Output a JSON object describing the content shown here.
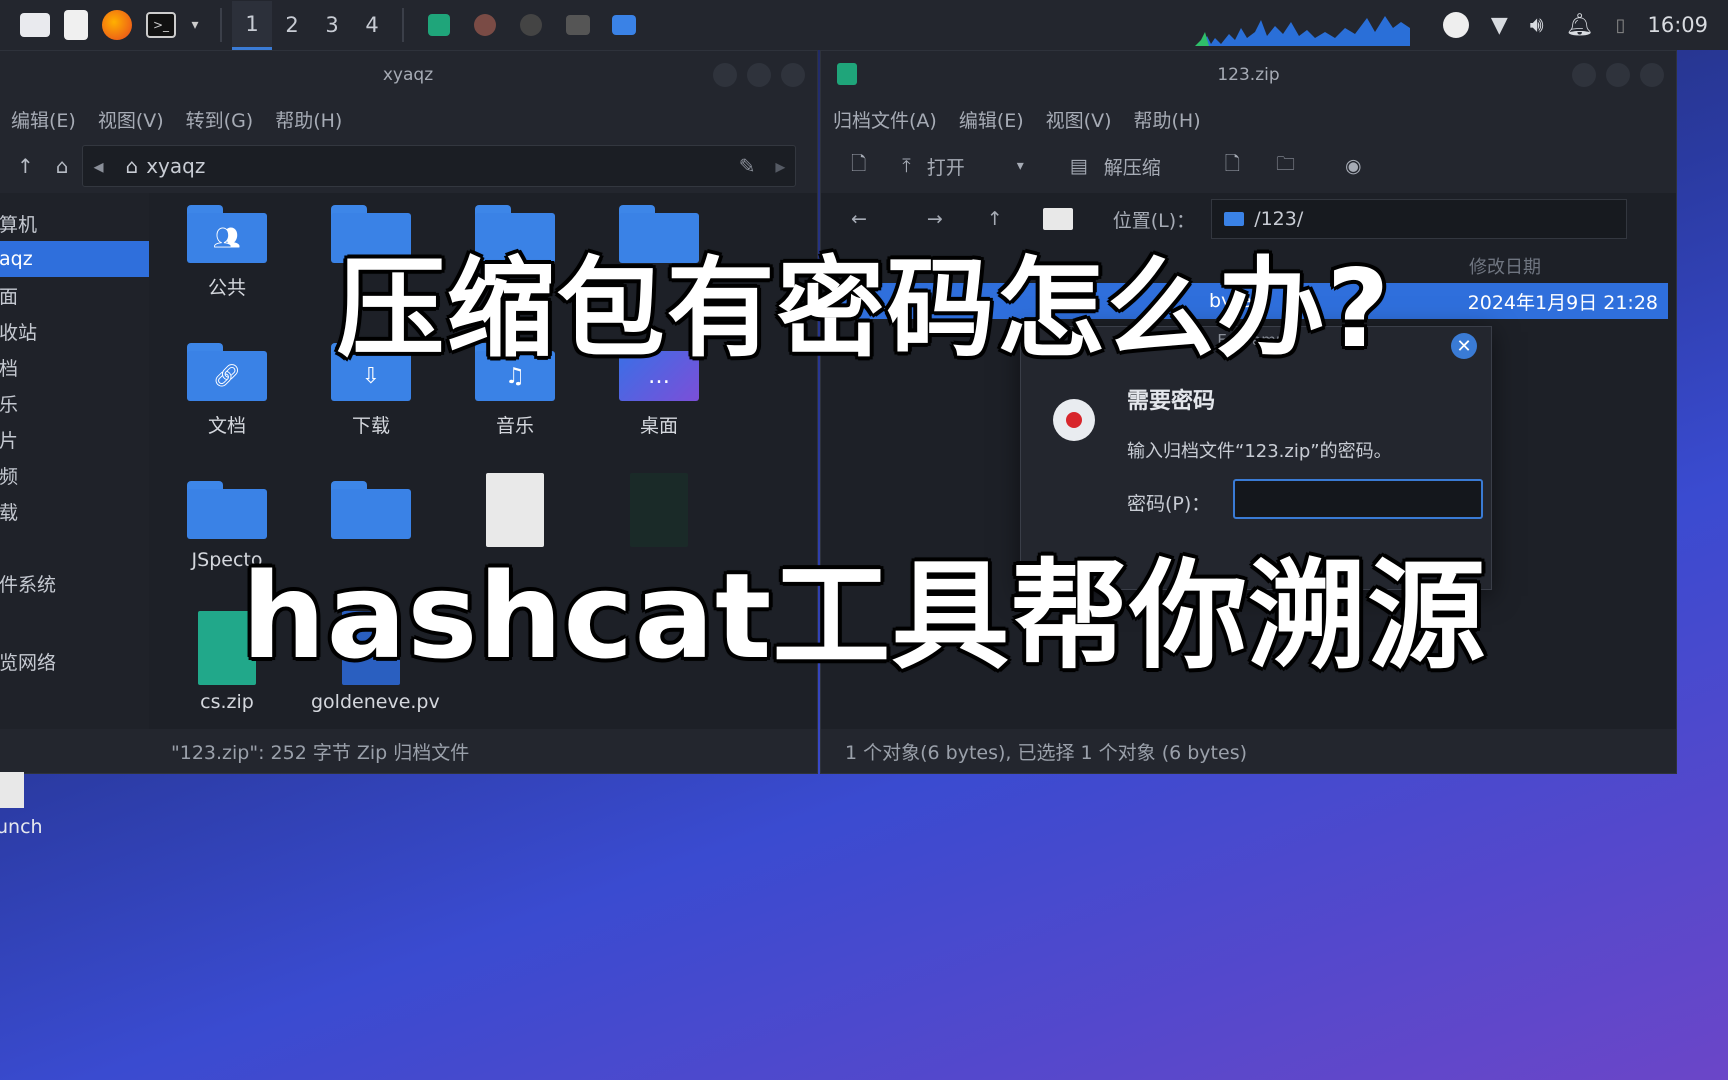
{
  "taskbar": {
    "workspaces": [
      "1",
      "2",
      "3",
      "4"
    ],
    "clock": "16:09"
  },
  "file_manager": {
    "title": "xyaqz",
    "menu": [
      "编辑(E)",
      "视图(V)",
      "转到(G)",
      "帮助(H)"
    ],
    "path": "xyaqz",
    "sidebar": [
      "算机",
      "aqz",
      "面",
      "收站",
      "档",
      "乐",
      "片",
      "频",
      "载",
      "件系统",
      "览网络"
    ],
    "files": [
      "公共",
      "文档",
      "下载",
      "音乐",
      "桌面",
      "JSpecto",
      "cs.zip",
      "goldeneve.pv"
    ],
    "status": "\"123.zip\": 252 字节 Zip 归档文件"
  },
  "archive_manager": {
    "title": "123.zip",
    "menu": [
      "归档文件(A)",
      "编辑(E)",
      "视图(V)",
      "帮助(H)"
    ],
    "toolbar": {
      "open": "打开",
      "extract": "解压缩"
    },
    "location_label": "位置(L)：",
    "location": "/123/",
    "columns": {
      "date": "修改日期"
    },
    "row": {
      "size": "bytes",
      "date": "2024年1月9日 21:28"
    },
    "status": "1 个对象(6 bytes), 已选择 1 个对象 (6 bytes)"
  },
  "dialog": {
    "title": "Engrampa",
    "heading": "需要密码",
    "message": "输入归档文件“123.zip”的密码。",
    "password_label": "密码(P)：",
    "password_value": ""
  },
  "desktop": {
    "icon_label": "unch"
  },
  "overlay": {
    "line1": "压缩包有密码怎么办?",
    "line2": "hashcat工具帮你溯源"
  },
  "colors": {
    "accent": "#2f6fdc",
    "folder": "#3a82e6"
  }
}
